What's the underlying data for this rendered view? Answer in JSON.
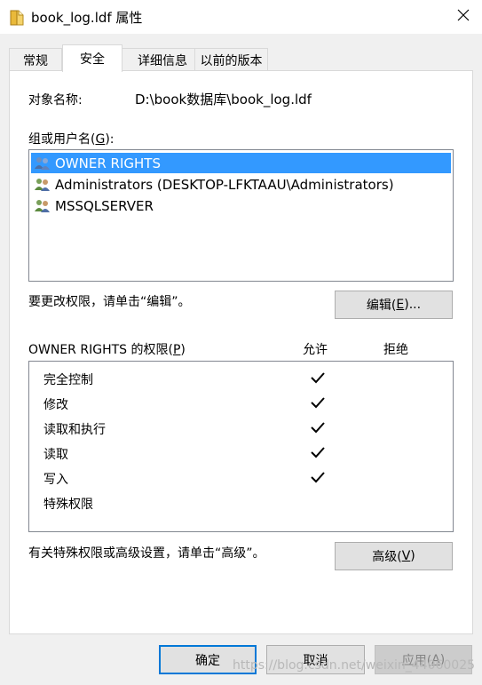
{
  "window": {
    "title": "book_log.ldf 属性",
    "icon": "file-icon",
    "close_icon": "close-icon"
  },
  "tabs": [
    {
      "label": "常规",
      "active": false
    },
    {
      "label": "安全",
      "active": true
    },
    {
      "label": "详细信息",
      "active": false
    },
    {
      "label": "以前的版本",
      "active": false
    }
  ],
  "object": {
    "label": "对象名称:",
    "value": "D:\\book数据库\\book_log.ldf"
  },
  "groups": {
    "label_prefix": "组或用户名(",
    "label_key": "G",
    "label_suffix": "):",
    "items": [
      {
        "name": "OWNER RIGHTS",
        "selected": true,
        "icon": "users-icon"
      },
      {
        "name": "Administrators (DESKTOP-LFKTAAU\\Administrators)",
        "selected": false,
        "icon": "users-icon"
      },
      {
        "name": "MSSQLSERVER",
        "selected": false,
        "icon": "users-icon"
      }
    ]
  },
  "edit_hint": "要更改权限，请单击“编辑”。",
  "edit_button": {
    "prefix": "编辑(",
    "key": "E",
    "suffix": ")..."
  },
  "permissions": {
    "title_prefix": "OWNER RIGHTS 的权限(",
    "title_key": "P",
    "title_suffix": ")",
    "allow_header": "允许",
    "deny_header": "拒绝",
    "rows": [
      {
        "name": "完全控制",
        "allow": true,
        "deny": false
      },
      {
        "name": "修改",
        "allow": true,
        "deny": false
      },
      {
        "name": "读取和执行",
        "allow": true,
        "deny": false
      },
      {
        "name": "读取",
        "allow": true,
        "deny": false
      },
      {
        "name": "写入",
        "allow": true,
        "deny": false
      },
      {
        "name": "特殊权限",
        "allow": false,
        "deny": false
      }
    ]
  },
  "advanced_hint": "有关特殊权限或高级设置，请单击“高级”。",
  "advanced_button": {
    "prefix": "高级(",
    "key": "V",
    "suffix": ")"
  },
  "footer": {
    "ok": "确定",
    "cancel": "取消",
    "apply_prefix": "应用(",
    "apply_key": "A",
    "apply_suffix": ")"
  },
  "watermark": "https://blog.csdn.net/weixin_44060025",
  "colors": {
    "selection": "#3399ff",
    "default_button_border": "#0078d7"
  }
}
